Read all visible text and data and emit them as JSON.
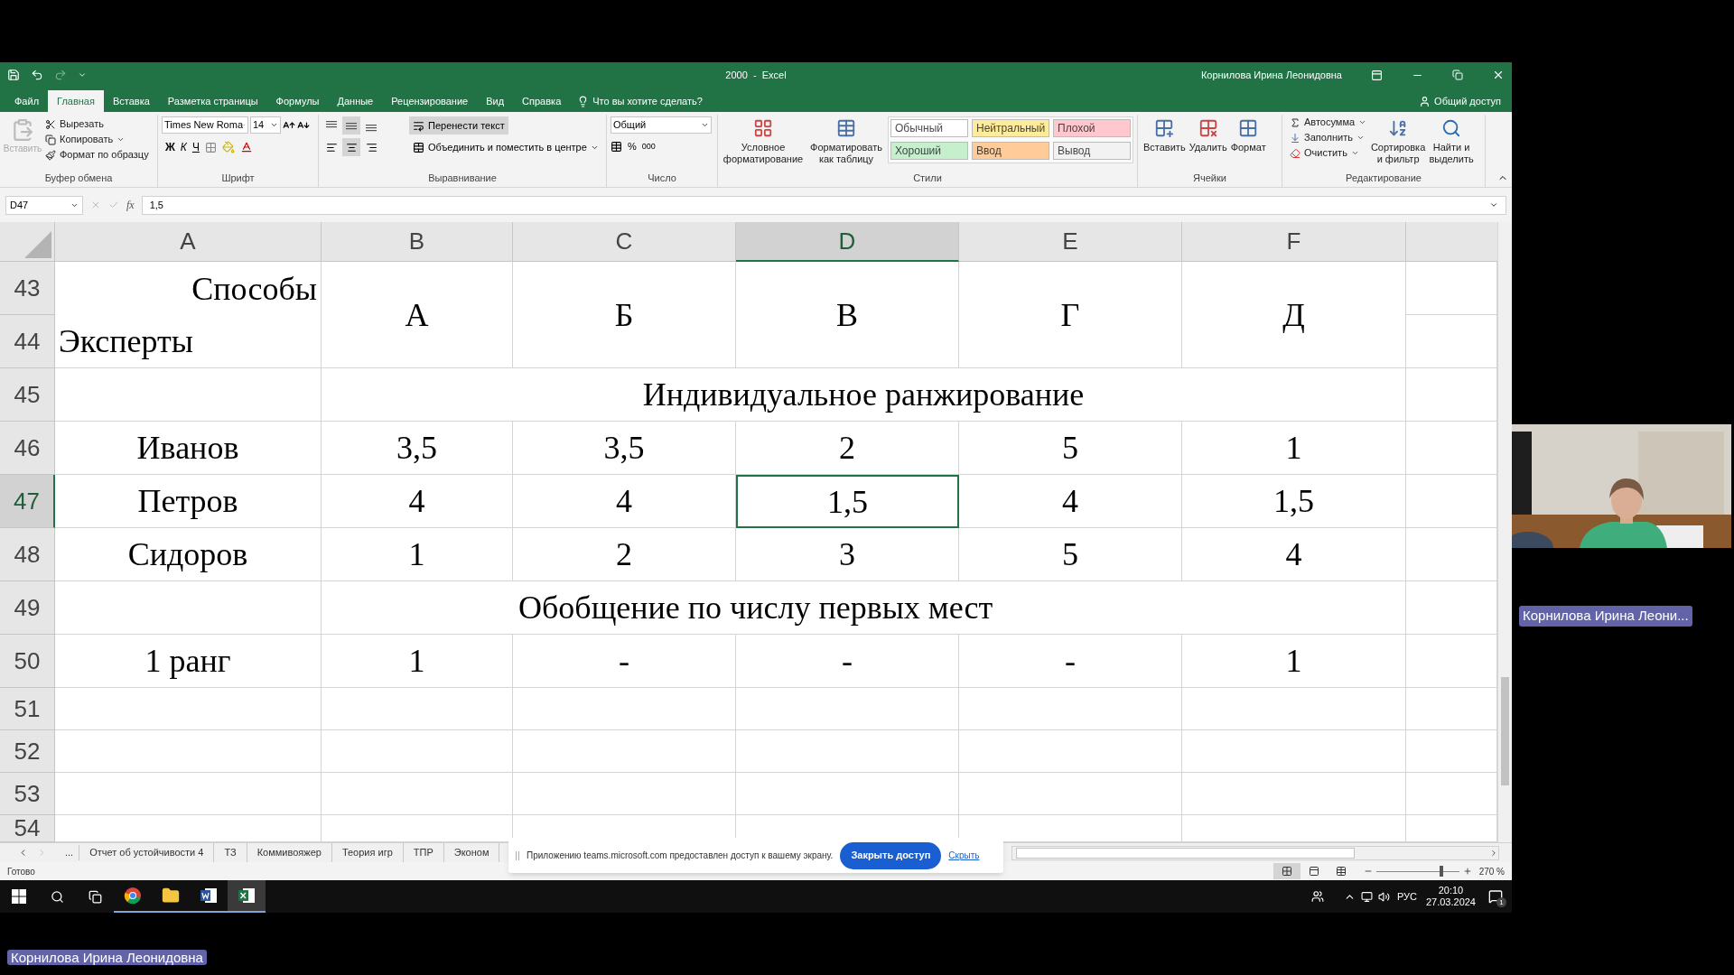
{
  "title_bar": {
    "title": "2000  -  Excel",
    "user": "Корнилова Ирина Леонидовна"
  },
  "ribbon_tabs": [
    {
      "label": "Файл",
      "selected": false
    },
    {
      "label": "Главная",
      "selected": true
    },
    {
      "label": "Вставка",
      "selected": false
    },
    {
      "label": "Разметка страницы",
      "selected": false
    },
    {
      "label": "Формулы",
      "selected": false
    },
    {
      "label": "Данные",
      "selected": false
    },
    {
      "label": "Рецензирование",
      "selected": false
    },
    {
      "label": "Вид",
      "selected": false
    },
    {
      "label": "Справка",
      "selected": false
    }
  ],
  "tell_me": "Что вы хотите сделать?",
  "share": "Общий доступ",
  "clipboard": {
    "paste": {
      "label": "Вставить",
      "disabled": true
    },
    "cut": "Вырезать",
    "copy": "Копировать",
    "format_painter": "Формат по образцу",
    "group": "Буфер обмена"
  },
  "font": {
    "name": "Times New Roma",
    "size": "14",
    "bold": "Ж",
    "italic": "К",
    "underline": "Ч",
    "group": "Шрифт"
  },
  "alignment": {
    "vertical": [
      {
        "selected": false
      },
      {
        "selected": true
      },
      {
        "selected": false
      }
    ],
    "horizontal": [
      {
        "selected": false
      },
      {
        "selected": true
      },
      {
        "selected": false
      }
    ],
    "wrap": {
      "label": "Перенести текст",
      "on": true
    },
    "merge": "Объединить и поместить в центре",
    "group": "Выравнивание"
  },
  "number": {
    "format": "Общий",
    "percent": "%",
    "thousands": "000",
    "group": "Число"
  },
  "styles": {
    "conditional": "Условное форматирование",
    "as_table": "Форматировать как таблицу",
    "cells": [
      {
        "label": "Обычный",
        "color": "#ffffff"
      },
      {
        "label": "Нейтральный",
        "color": "#ffeb9c"
      },
      {
        "label": "Плохой",
        "color": "#ffc7ce"
      },
      {
        "label": "Хороший",
        "color": "#c6efce"
      },
      {
        "label": "Ввод",
        "color": "#ffcc99"
      },
      {
        "label": "Вывод",
        "color": "#f2f2f2"
      }
    ],
    "group": "Стили"
  },
  "cells_group": {
    "insert": "Вставить",
    "delete": "Удалить",
    "format": "Формат",
    "group": "Ячейки"
  },
  "editing": {
    "autosum": "Автосумма",
    "fill": "Заполнить",
    "clear": "Очистить",
    "sort": "Сортировка и фильтр",
    "find": "Найти и выделить",
    "group": "Редактирование"
  },
  "formula_bar": {
    "name_box": "D47",
    "fx": "fx",
    "value": "1,5"
  },
  "sheet": {
    "columns": [
      {
        "label": "A",
        "selected": false
      },
      {
        "label": "B",
        "selected": false
      },
      {
        "label": "C",
        "selected": false
      },
      {
        "label": "D",
        "selected": true
      },
      {
        "label": "E",
        "selected": false
      },
      {
        "label": "F",
        "selected": false
      }
    ],
    "rows": [
      {
        "number": "43",
        "selected": false
      },
      {
        "number": "44",
        "selected": false
      },
      {
        "number": "45",
        "selected": false
      },
      {
        "number": "46",
        "selected": false
      },
      {
        "number": "47",
        "selected": true
      },
      {
        "number": "48",
        "selected": false
      },
      {
        "number": "49",
        "selected": false
      },
      {
        "number": "50",
        "selected": false
      },
      {
        "number": "51",
        "selected": false
      },
      {
        "number": "52",
        "selected": false
      },
      {
        "number": "53",
        "selected": false
      },
      {
        "number": "54",
        "selected": false
      }
    ],
    "corner_top": "Способы",
    "corner_bottom": "Эксперты",
    "methods": [
      "А",
      "Б",
      "В",
      "Г",
      "Д"
    ],
    "section_1": "Индивидуальное ранжирование",
    "experts": [
      {
        "name": "Иванов",
        "values": [
          {
            "text": "3,5",
            "selected": false
          },
          {
            "text": "3,5",
            "selected": false
          },
          {
            "text": "2",
            "selected": false
          },
          {
            "text": "5",
            "selected": false
          },
          {
            "text": "1",
            "selected": false
          }
        ]
      },
      {
        "name": "Петров",
        "values": [
          {
            "text": "4",
            "selected": false
          },
          {
            "text": "4",
            "selected": false
          },
          {
            "text": "1,5",
            "selected": true
          },
          {
            "text": "4",
            "selected": false
          },
          {
            "text": "1,5",
            "selected": false
          }
        ]
      },
      {
        "name": "Сидоров",
        "values": [
          {
            "text": "1",
            "selected": false
          },
          {
            "text": "2",
            "selected": false
          },
          {
            "text": "3",
            "selected": false
          },
          {
            "text": "5",
            "selected": false
          },
          {
            "text": "4",
            "selected": false
          }
        ]
      }
    ],
    "section_2": "Обобщение по числу первых мест",
    "summary": {
      "label": "1 ранг",
      "values": [
        "1",
        "-",
        "-",
        "-",
        "1"
      ]
    }
  },
  "sheet_tabs": {
    "more": "...",
    "tabs": [
      {
        "label": "Отчет об устойчивости 4",
        "selected": false
      },
      {
        "label": "ТЗ",
        "selected": false
      },
      {
        "label": "Коммивояжер",
        "selected": false
      },
      {
        "label": "Теория игр",
        "selected": false
      },
      {
        "label": "ТПР",
        "selected": false
      },
      {
        "label": "Эконом",
        "selected": false
      }
    ]
  },
  "status_bar": {
    "status": "Готово",
    "view_modes": [
      {
        "selected": true
      },
      {
        "selected": false
      },
      {
        "selected": false
      }
    ],
    "zoom_slider": {
      "level": 0.8
    },
    "zoom": "270 %"
  },
  "share_banner": {
    "message": "Приложению teams.microsoft.com предоставлен доступ к вашему экрану.",
    "stop_button": "Закрыть доступ",
    "hide_link": "Скрыть"
  },
  "taskbar": {
    "apps": [
      {
        "kind": "browser",
        "running": true,
        "selected": false
      },
      {
        "kind": "folder",
        "running": true,
        "selected": false
      },
      {
        "kind": "document",
        "running": true,
        "selected": false
      },
      {
        "kind": "spreadsheet",
        "running": true,
        "selected": true
      }
    ],
    "language": "РУС",
    "time": "20:10",
    "date": "27.03.2024",
    "notifications": "1"
  },
  "video": {
    "name": "Корнилова Ирина Леони..."
  },
  "presenter_label": "Корнилова Ирина Леонидовна"
}
